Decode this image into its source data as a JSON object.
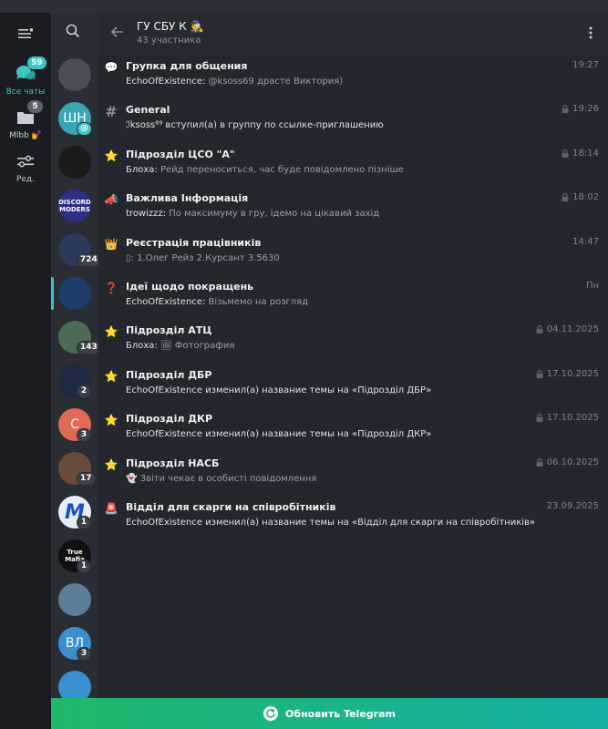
{
  "window": {
    "title": "ГУ СБУ К",
    "title_emoji": "🕵",
    "subtitle": "43 участника"
  },
  "folders": [
    {
      "label": "Все чаты",
      "badge": "59",
      "icon": "chat-bubbles-icon",
      "active": true
    },
    {
      "label": "Mlbb",
      "label_emoji": "💅",
      "badge": "5",
      "icon": "folder-icon",
      "active": false
    },
    {
      "label": "Ред.",
      "badge": "",
      "icon": "edit-sliders-icon",
      "active": false
    }
  ],
  "avatars": [
    {
      "text": "",
      "badge": "",
      "icon": "archive-icon",
      "color": "#4a4e57"
    },
    {
      "text": "ШН",
      "badge": "",
      "mention": "@",
      "color": "#3aa6b3"
    },
    {
      "text": "",
      "badge": "",
      "icon": "black-cat-photo",
      "color": "#1b1b1b"
    },
    {
      "text": "DISCORD MODERS",
      "badge": "",
      "color": "#2d2f86"
    },
    {
      "text": "",
      "badge": "724",
      "color": "#2c3a5c"
    },
    {
      "text": "",
      "badge": "",
      "color": "#1f3d6b",
      "selected": true
    },
    {
      "text": "",
      "badge": "143",
      "color": "#4d6a55"
    },
    {
      "text": "",
      "badge": "2",
      "icon": "police-badge-icon",
      "color": "#1f2a44"
    },
    {
      "text": "С",
      "badge": "3",
      "color": "#e06a55"
    },
    {
      "text": "",
      "badge": "17",
      "color": "#6a4a3a"
    },
    {
      "text": "M",
      "badge": "1",
      "color": "#e9eef6",
      "text_color": "#1a4fd1"
    },
    {
      "text": "True Mafia",
      "badge": "1",
      "color": "#111111"
    },
    {
      "text": "",
      "badge": "",
      "color": "#5b7f9a"
    },
    {
      "text": "ВЛ",
      "badge": "3",
      "color": "#3a8fd1"
    },
    {
      "text": "",
      "badge": "",
      "icon": "bookmark-icon",
      "color": "#3a8fd1"
    }
  ],
  "topics": [
    {
      "icon": "💬",
      "title": "Групка для общения",
      "sender": "EchoOfExistence:",
      "preview": "@ksoss69 драсте Виктория)",
      "time": "19:27",
      "locked": false
    },
    {
      "icon": "#",
      "title": "General",
      "sender": "",
      "preview": "ℐksoss⁶⁹ вступил(а) в группу по ссылке-приглашению",
      "time": "19:26",
      "locked": true
    },
    {
      "icon": "⭐",
      "title": "Підрозділ ЦСО \"А\"",
      "sender": "Блоха:",
      "preview": "Рейд переноситься, час буде повідомлено пізніше",
      "time": "18:14",
      "locked": true
    },
    {
      "icon": "📣",
      "title": "Важлива Інформація",
      "sender": "trowizzz:",
      "preview": "По максимуму в гру, ідемо на цікавий захід",
      "time": "18:02",
      "locked": true
    },
    {
      "icon": "👑",
      "title": "Реєстрація працівників",
      "sender": "",
      "preview": "1.Олег Рейз 2.Курсант 3.5630",
      "preview_prefix": "▯:",
      "time": "14:47",
      "locked": false
    },
    {
      "icon": "❓",
      "title": "Ідеї щодо покращень",
      "sender": "EchoOfExistence:",
      "preview": "Візьмемо на розгляд",
      "time": "Пн",
      "locked": false
    },
    {
      "icon": "⭐",
      "title": "Підрозділ АТЦ",
      "sender": "Блоха:",
      "preview": "Фотография",
      "preview_prefix": "🖼",
      "time": "04.11.2025",
      "locked": true
    },
    {
      "icon": "⭐",
      "title": "Підрозділ ДБР",
      "sender": "",
      "preview": "EchoOfExistence изменил(а) название темы на «Підрозділ ДБР»",
      "time": "17.10.2025",
      "locked": true
    },
    {
      "icon": "⭐",
      "title": "Підрозділ ДКР",
      "sender": "",
      "preview": "EchoOfExistence изменил(а) название темы на «Підрозділ ДКР»",
      "time": "17.10.2025",
      "locked": true
    },
    {
      "icon": "⭐",
      "title": "Підрозділ НАСБ",
      "sender": "",
      "preview": "Звіти чекає в особисті повідомлення",
      "preview_prefix": "👻",
      "time": "06.10.2025",
      "locked": true
    },
    {
      "icon": "🚨",
      "title": "Відділ для скарги на співробітників",
      "sender": "",
      "preview": "EchoOfExistence изменил(а) название темы на «Відділ для скарги на співробітників»",
      "time": "23.09.2025",
      "locked": false
    }
  ],
  "update_bar": {
    "label": "Обновить Telegram",
    "icon": "refresh-icon"
  },
  "colors": {
    "accent": "#3ec6c3",
    "update_start": "#1fb86a",
    "update_end": "#13b0a4"
  }
}
